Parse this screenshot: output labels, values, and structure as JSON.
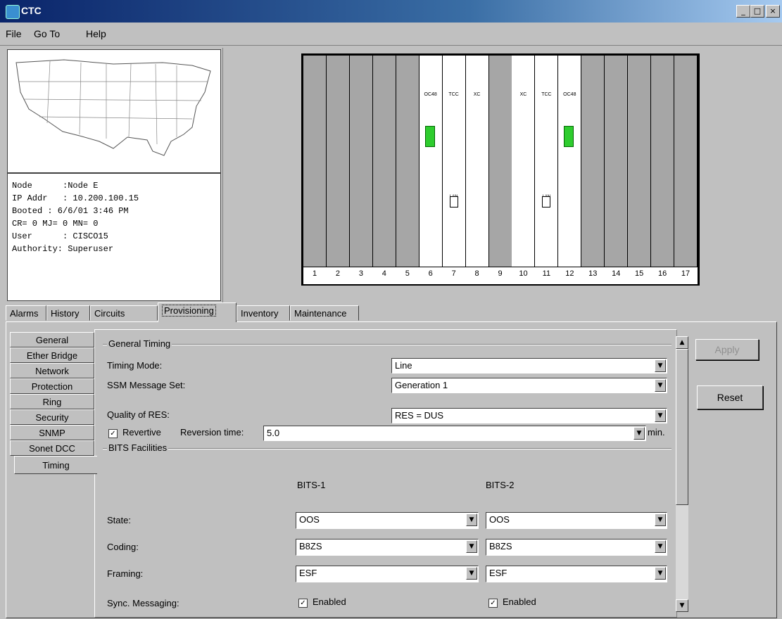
{
  "window": {
    "title": "CTC",
    "minimize": "_",
    "maximize": "□",
    "close": "×"
  },
  "menu": {
    "items": [
      "File",
      "Go To",
      "Help"
    ]
  },
  "node_info": {
    "node": "Node      :Node E",
    "ip": "IP Addr   : 10.200.100.15",
    "booted": "Booted : 6/6/01 3:46 PM",
    "alarms": "CR= 0 MJ= 0 MN= 0",
    "user": "User      : CISCO15",
    "authority": "Authority: Superuser"
  },
  "shelf": {
    "slot_numbers": [
      "1",
      "2",
      "3",
      "4",
      "5",
      "6",
      "7",
      "8",
      "9",
      "10",
      "11",
      "12",
      "13",
      "14",
      "15",
      "16",
      "17"
    ],
    "cards": {
      "6": "OC48",
      "7": "TCC",
      "8": "XC",
      "10": "XC",
      "11": "TCC",
      "12": "OC48"
    },
    "lan_label": "LAN"
  },
  "tabs": [
    "Alarms",
    "History",
    "Circuits",
    "Provisioning",
    "Inventory",
    "Maintenance"
  ],
  "active_tab": "Provisioning",
  "side_tabs": [
    "General",
    "Ether Bridge",
    "Network",
    "Protection",
    "Ring",
    "Security",
    "SNMP",
    "Sonet DCC",
    "Timing"
  ],
  "active_side_tab": "Timing",
  "general_timing": {
    "title": "General Timing",
    "timing_mode_label": "Timing Mode:",
    "timing_mode_value": "Line",
    "ssm_label": "SSM Message Set:",
    "ssm_value": "Generation 1",
    "quality_label": "Quality of RES:",
    "quality_value": "RES = DUS",
    "revertive_label": "Revertive",
    "revertive_checked": true,
    "reversion_label": "Reversion time:",
    "reversion_value": "5.0",
    "reversion_unit": "min."
  },
  "bits": {
    "title": "BITS Facilities",
    "col1": "BITS-1",
    "col2": "BITS-2",
    "state_label": "State:",
    "state1": "OOS",
    "state2": "OOS",
    "coding_label": "Coding:",
    "coding1": "B8ZS",
    "coding2": "B8ZS",
    "framing_label": "Framing:",
    "framing1": "ESF",
    "framing2": "ESF",
    "sync_label": "Sync. Messaging:",
    "sync1": "Enabled",
    "sync2": "Enabled"
  },
  "buttons": {
    "apply": "Apply",
    "reset": "Reset"
  },
  "colors": {
    "led": "#2ecc2e",
    "titlebar": "#0a246a",
    "disabled_text": "#909090"
  }
}
